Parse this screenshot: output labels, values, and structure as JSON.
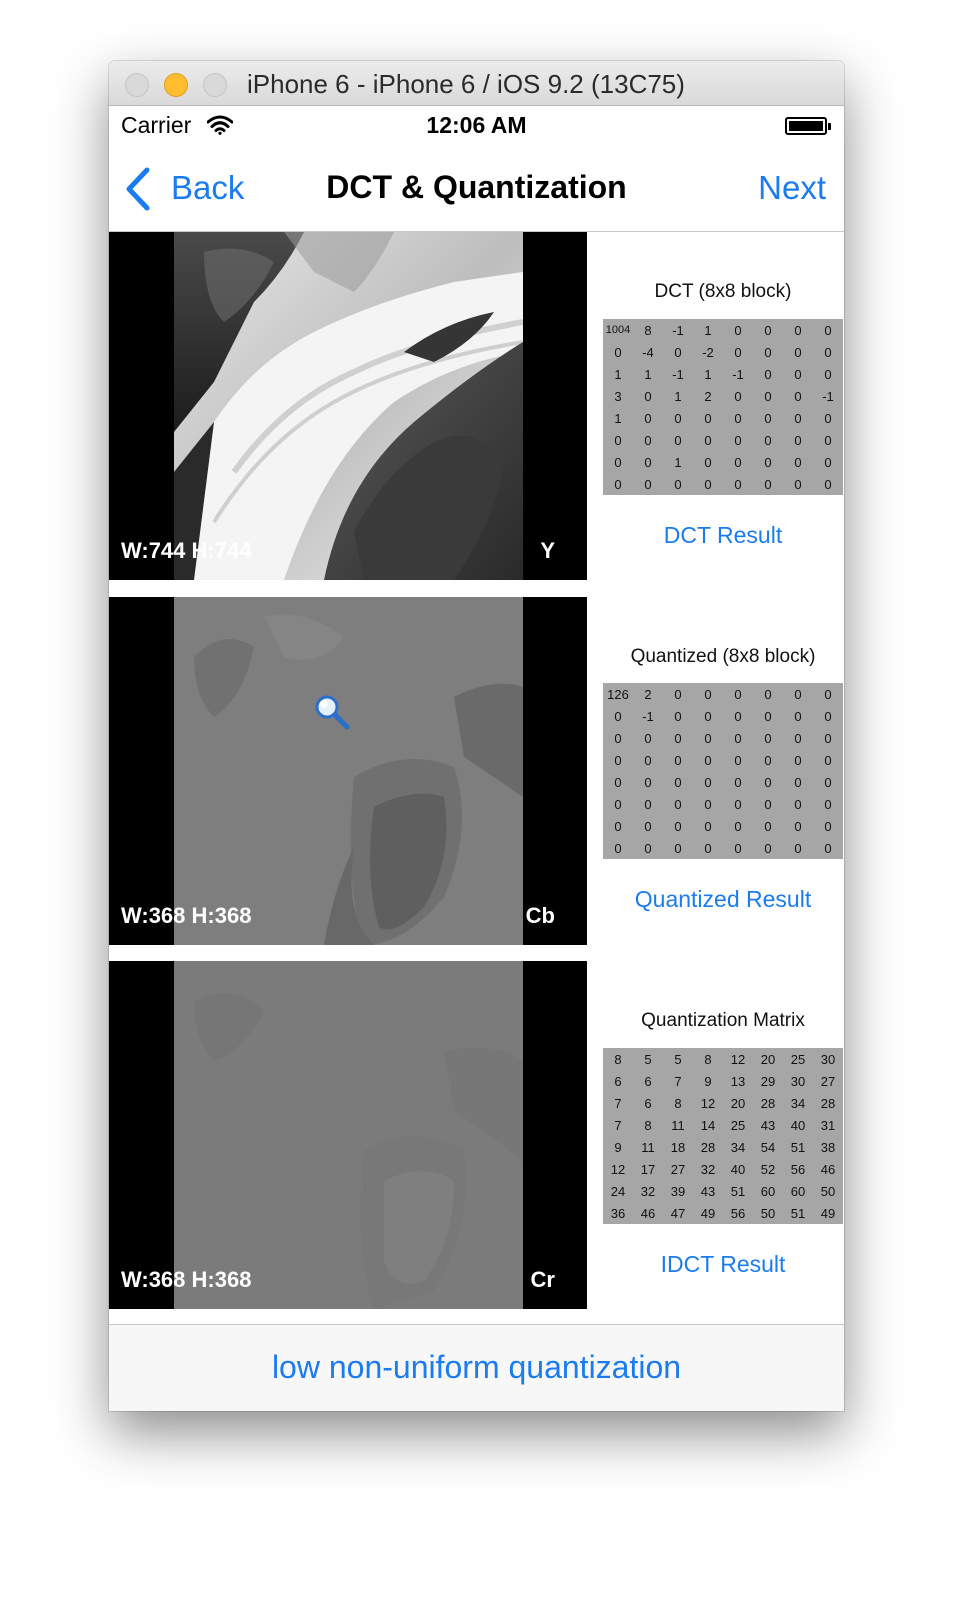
{
  "window": {
    "title": "iPhone 6 - iPhone 6 / iOS 9.2 (13C75)"
  },
  "status_bar": {
    "carrier": "Carrier",
    "time": "12:06 AM"
  },
  "nav": {
    "back": "Back",
    "title": "DCT & Quantization",
    "next": "Next"
  },
  "panels": [
    {
      "dims": "W:744  H:744",
      "channel": "Y"
    },
    {
      "dims": "W:368  H:368",
      "channel": "Cb"
    },
    {
      "dims": "W:368  H:368",
      "channel": "Cr"
    }
  ],
  "dct": {
    "title": "DCT (8x8 block)",
    "button": "DCT Result",
    "rows": [
      [
        "1004",
        "8",
        "-1",
        "1",
        "0",
        "0",
        "0",
        "0"
      ],
      [
        "0",
        "-4",
        "0",
        "-2",
        "0",
        "0",
        "0",
        "0"
      ],
      [
        "1",
        "1",
        "-1",
        "1",
        "-1",
        "0",
        "0",
        "0"
      ],
      [
        "3",
        "0",
        "1",
        "2",
        "0",
        "0",
        "0",
        "-1"
      ],
      [
        "1",
        "0",
        "0",
        "0",
        "0",
        "0",
        "0",
        "0"
      ],
      [
        "0",
        "0",
        "0",
        "0",
        "0",
        "0",
        "0",
        "0"
      ],
      [
        "0",
        "0",
        "1",
        "0",
        "0",
        "0",
        "0",
        "0"
      ],
      [
        "0",
        "0",
        "0",
        "0",
        "0",
        "0",
        "0",
        "0"
      ]
    ]
  },
  "quantized": {
    "title": "Quantized (8x8 block)",
    "button": "Quantized Result",
    "rows": [
      [
        "126",
        "2",
        "0",
        "0",
        "0",
        "0",
        "0",
        "0"
      ],
      [
        "0",
        "-1",
        "0",
        "0",
        "0",
        "0",
        "0",
        "0"
      ],
      [
        "0",
        "0",
        "0",
        "0",
        "0",
        "0",
        "0",
        "0"
      ],
      [
        "0",
        "0",
        "0",
        "0",
        "0",
        "0",
        "0",
        "0"
      ],
      [
        "0",
        "0",
        "0",
        "0",
        "0",
        "0",
        "0",
        "0"
      ],
      [
        "0",
        "0",
        "0",
        "0",
        "0",
        "0",
        "0",
        "0"
      ],
      [
        "0",
        "0",
        "0",
        "0",
        "0",
        "0",
        "0",
        "0"
      ],
      [
        "0",
        "0",
        "0",
        "0",
        "0",
        "0",
        "0",
        "0"
      ]
    ]
  },
  "qmatrix": {
    "title": "Quantization Matrix",
    "button": "IDCT Result",
    "rows": [
      [
        "8",
        "5",
        "5",
        "8",
        "12",
        "20",
        "25",
        "30"
      ],
      [
        "6",
        "6",
        "7",
        "9",
        "13",
        "29",
        "30",
        "27"
      ],
      [
        "7",
        "6",
        "8",
        "12",
        "20",
        "28",
        "34",
        "28"
      ],
      [
        "7",
        "8",
        "11",
        "14",
        "25",
        "43",
        "40",
        "31"
      ],
      [
        "9",
        "11",
        "18",
        "28",
        "34",
        "54",
        "51",
        "38"
      ],
      [
        "12",
        "17",
        "27",
        "32",
        "40",
        "52",
        "56",
        "46"
      ],
      [
        "24",
        "32",
        "39",
        "43",
        "51",
        "60",
        "60",
        "50"
      ],
      [
        "36",
        "46",
        "47",
        "49",
        "56",
        "50",
        "51",
        "49"
      ]
    ]
  },
  "bottom": {
    "label": "low non-uniform quantization"
  },
  "colors": {
    "accent": "#1a7cf0",
    "matrix_bg": "#a6a6a6"
  }
}
